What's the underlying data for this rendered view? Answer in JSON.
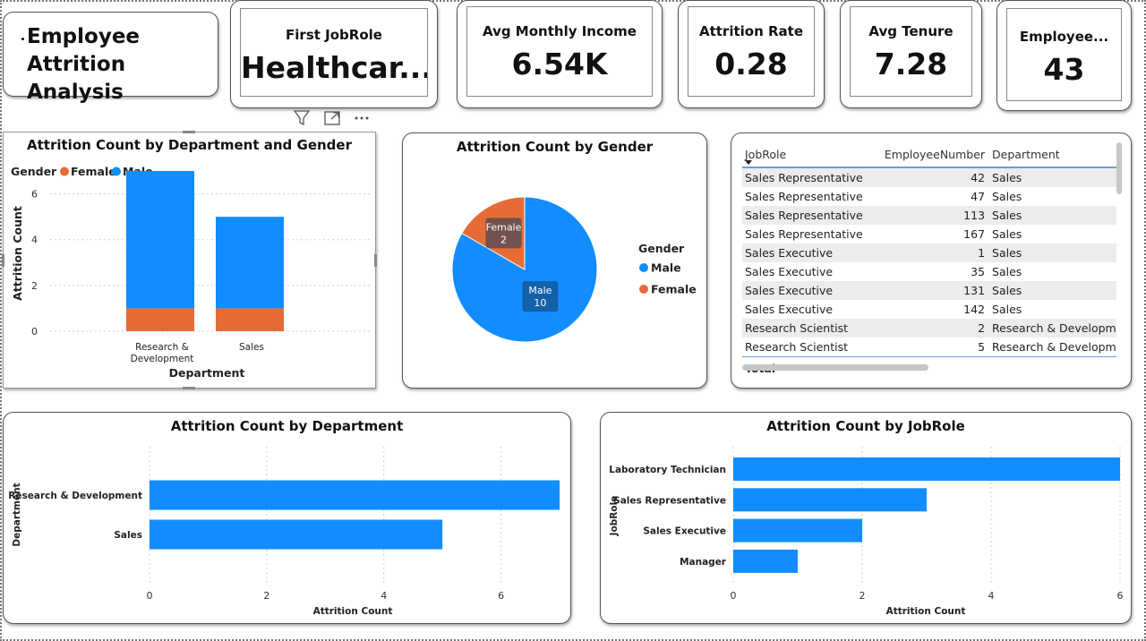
{
  "dashboard": {
    "title_line1": "Employee",
    "title_line2": "Attrition Analysis"
  },
  "kpis": [
    {
      "label": "First JobRole",
      "value": "Healthcar..."
    },
    {
      "label": "Avg Monthly Income",
      "value": "6.54K"
    },
    {
      "label": "Attrition Rate",
      "value": "0.28"
    },
    {
      "label": "Avg Tenure",
      "value": "7.28"
    },
    {
      "label": "Employee...",
      "value": "43"
    }
  ],
  "toolbar": {
    "filter_icon": "filter-icon",
    "focus_icon": "focus-mode-icon",
    "more_icon": "more-options-icon",
    "more_label": "···"
  },
  "table": {
    "columns": [
      "JobRole",
      "EmployeeNumber",
      "Department"
    ],
    "rows": [
      [
        "Sales Representative",
        "42",
        "Sales"
      ],
      [
        "Sales Representative",
        "47",
        "Sales"
      ],
      [
        "Sales Representative",
        "113",
        "Sales"
      ],
      [
        "Sales Representative",
        "167",
        "Sales"
      ],
      [
        "Sales Executive",
        "1",
        "Sales"
      ],
      [
        "Sales Executive",
        "35",
        "Sales"
      ],
      [
        "Sales Executive",
        "131",
        "Sales"
      ],
      [
        "Sales Executive",
        "142",
        "Sales"
      ],
      [
        "Research Scientist",
        "2",
        "Research & Developme"
      ],
      [
        "Research Scientist",
        "5",
        "Research & Developme"
      ]
    ],
    "total_label": "Total"
  },
  "colors": {
    "male": "#118DFF",
    "female": "#E66C37",
    "grid": "#d0d0d0"
  },
  "chart_data": [
    {
      "type": "bar",
      "stacked": true,
      "title": "Attrition Count by Department and Gender",
      "legend_title": "Gender",
      "legend_position": "top-left",
      "categories": [
        "Research & Development",
        "Sales"
      ],
      "category_lines": [
        [
          "Research &",
          "Development"
        ],
        [
          "Sales"
        ]
      ],
      "series": [
        {
          "name": "Female",
          "values": [
            1,
            1
          ]
        },
        {
          "name": "Male",
          "values": [
            6,
            4
          ]
        }
      ],
      "xlabel": "Department",
      "ylabel": "Attrition Count",
      "ylim": [
        0,
        7
      ],
      "yticks": [
        0,
        2,
        4,
        6
      ],
      "grid": true
    },
    {
      "type": "pie",
      "title": "Attrition Count by Gender",
      "legend_title": "Gender",
      "legend_position": "right",
      "slices": [
        {
          "name": "Male",
          "value": 10
        },
        {
          "name": "Female",
          "value": 2
        }
      ]
    },
    {
      "type": "bar",
      "orientation": "horizontal",
      "title": "Attrition Count by Department",
      "categories": [
        "Research & Development",
        "Sales"
      ],
      "values": [
        7,
        5
      ],
      "xlabel": "Attrition Count",
      "ylabel": "Department",
      "xlim": [
        0,
        7
      ],
      "xticks": [
        0,
        2,
        4,
        6
      ],
      "grid": true
    },
    {
      "type": "bar",
      "orientation": "horizontal",
      "title": "Attrition Count by JobRole",
      "categories": [
        "Laboratory Technician",
        "Sales Representative",
        "Sales Executive",
        "Manager"
      ],
      "values": [
        6,
        3,
        2,
        1
      ],
      "xlabel": "Attrition Count",
      "ylabel": "JobRole",
      "xlim": [
        0,
        6
      ],
      "xticks": [
        0,
        2,
        4,
        6
      ],
      "grid": true
    }
  ]
}
